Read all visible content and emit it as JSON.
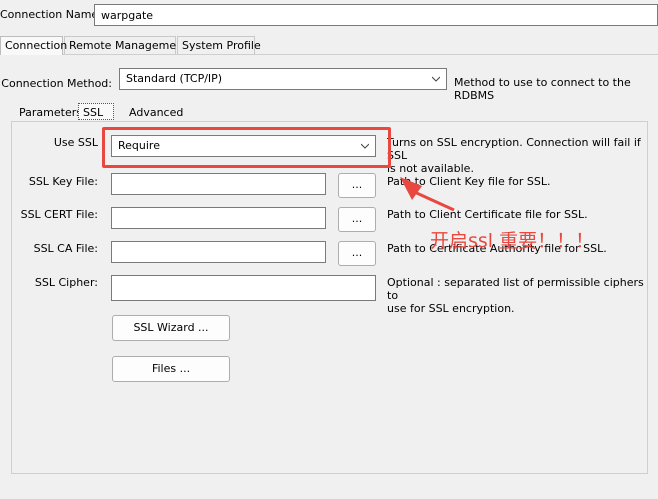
{
  "connection_name": {
    "label": "Connection Name:",
    "value": "warpgate"
  },
  "top_tabs": [
    "Connection",
    "Remote Management",
    "System Profile"
  ],
  "method": {
    "label": "Connection Method:",
    "value": "Standard (TCP/IP)",
    "desc": "Method to use to connect to the RDBMS"
  },
  "sub_tabs": [
    "Parameters",
    "SSL",
    "Advanced"
  ],
  "ssl": {
    "use_ssl": {
      "label": "Use SSL",
      "value": "Require",
      "desc_line1": "Turns on SSL encryption. Connection will fail if SSL",
      "desc_line2": "is not available."
    },
    "key_file": {
      "label": "SSL Key File:",
      "value": "",
      "browse": "...",
      "desc": "Path to Client Key file for SSL."
    },
    "cert_file": {
      "label": "SSL CERT File:",
      "value": "",
      "browse": "...",
      "desc": "Path to Client Certificate file for SSL."
    },
    "ca_file": {
      "label": "SSL CA File:",
      "value": "",
      "browse": "...",
      "desc": "Path to Certificate Authority file for SSL."
    },
    "cipher": {
      "label": "SSL Cipher:",
      "value": "",
      "desc_line1": "Optional : separated list of permissible ciphers to",
      "desc_line2": "use for SSL encryption."
    },
    "wizard_button": "SSL Wizard ...",
    "files_button": "Files ..."
  },
  "annotation": {
    "text": "开启ssl 重要！！！",
    "color": "#e8483f"
  }
}
